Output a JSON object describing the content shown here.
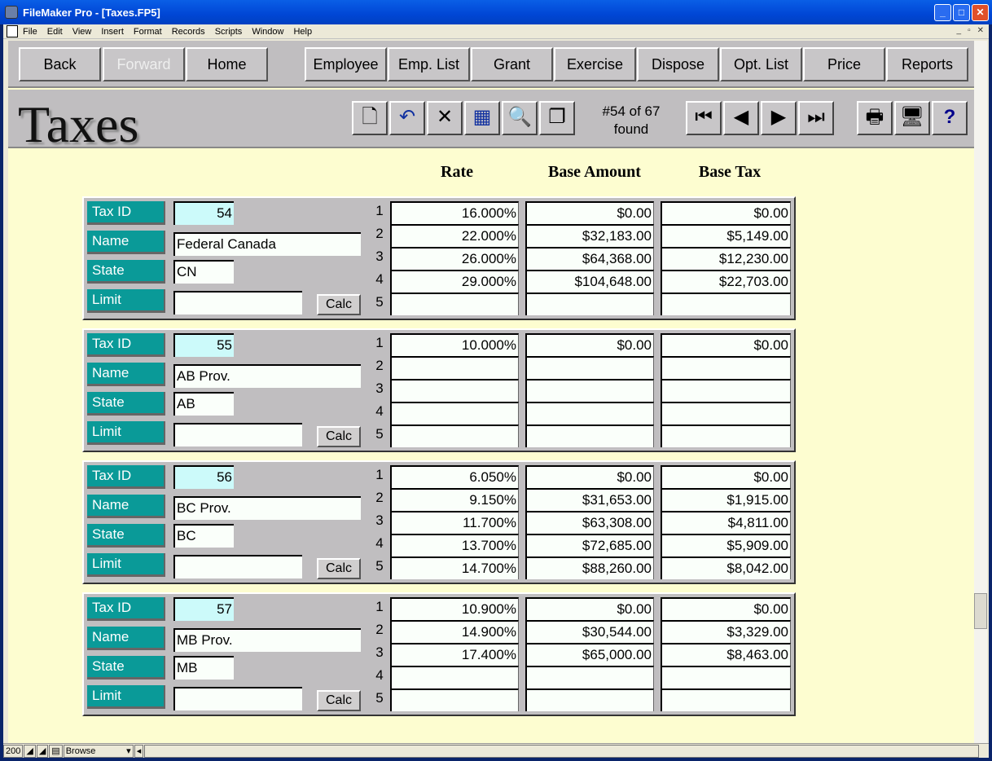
{
  "window": {
    "title": "FileMaker Pro - [Taxes.FP5]"
  },
  "menu": [
    "File",
    "Edit",
    "View",
    "Insert",
    "Format",
    "Records",
    "Scripts",
    "Window",
    "Help"
  ],
  "nav": [
    {
      "label": "Back",
      "enabled": true
    },
    {
      "label": "Forward",
      "enabled": false
    },
    {
      "label": "Home",
      "enabled": true
    },
    {
      "label": "Employee",
      "enabled": true
    },
    {
      "label": "Emp. List",
      "enabled": true
    },
    {
      "label": "Grant",
      "enabled": true
    },
    {
      "label": "Exercise",
      "enabled": true
    },
    {
      "label": "Dispose",
      "enabled": true
    },
    {
      "label": "Opt. List",
      "enabled": true
    },
    {
      "label": "Price",
      "enabled": true
    },
    {
      "label": "Reports",
      "enabled": true
    }
  ],
  "layout_title": "Taxes",
  "toolbar": {
    "found_line1": "#54 of 67",
    "found_line2": "found",
    "icons": [
      "new-record-icon",
      "undo-icon",
      "delete-icon",
      "table-view-icon",
      "find-icon",
      "duplicate-icon",
      "first-record-icon",
      "prev-record-icon",
      "next-record-icon",
      "last-record-icon",
      "print-icon",
      "computer-icon",
      "help-icon"
    ]
  },
  "columns": {
    "rate": "Rate",
    "base_amount": "Base Amount",
    "base_tax": "Base Tax"
  },
  "labels": {
    "tax_id": "Tax ID",
    "name": "Name",
    "state": "State",
    "limit": "Limit",
    "calc": "Calc"
  },
  "row_numbers": [
    "1",
    "2",
    "3",
    "4",
    "5"
  ],
  "records": [
    {
      "tax_id": "54",
      "name": "Federal Canada",
      "state": "CN",
      "limit": "",
      "rows": [
        [
          "16.000%",
          "$0.00",
          "$0.00"
        ],
        [
          "22.000%",
          "$32,183.00",
          "$5,149.00"
        ],
        [
          "26.000%",
          "$64,368.00",
          "$12,230.00"
        ],
        [
          "29.000%",
          "$104,648.00",
          "$22,703.00"
        ],
        [
          "",
          "",
          ""
        ]
      ]
    },
    {
      "tax_id": "55",
      "name": "AB Prov.",
      "state": "AB",
      "limit": "",
      "rows": [
        [
          "10.000%",
          "$0.00",
          "$0.00"
        ],
        [
          "",
          "",
          ""
        ],
        [
          "",
          "",
          ""
        ],
        [
          "",
          "",
          ""
        ],
        [
          "",
          "",
          ""
        ]
      ]
    },
    {
      "tax_id": "56",
      "name": "BC Prov.",
      "state": "BC",
      "limit": "",
      "rows": [
        [
          "6.050%",
          "$0.00",
          "$0.00"
        ],
        [
          "9.150%",
          "$31,653.00",
          "$1,915.00"
        ],
        [
          "11.700%",
          "$63,308.00",
          "$4,811.00"
        ],
        [
          "13.700%",
          "$72,685.00",
          "$5,909.00"
        ],
        [
          "14.700%",
          "$88,260.00",
          "$8,042.00"
        ]
      ]
    },
    {
      "tax_id": "57",
      "name": "MB Prov.",
      "state": "MB",
      "limit": "",
      "rows": [
        [
          "10.900%",
          "$0.00",
          "$0.00"
        ],
        [
          "14.900%",
          "$30,544.00",
          "$3,329.00"
        ],
        [
          "17.400%",
          "$65,000.00",
          "$8,463.00"
        ],
        [
          "",
          "",
          ""
        ],
        [
          "",
          "",
          ""
        ]
      ]
    }
  ],
  "status": {
    "zoom": "200",
    "mode": "Browse"
  },
  "colors": {
    "label_bg": "#0a9a98",
    "id_field_bg": "#ccfafa",
    "content_bg": "#fdfdd0",
    "band_bg": "#c0bec0"
  }
}
